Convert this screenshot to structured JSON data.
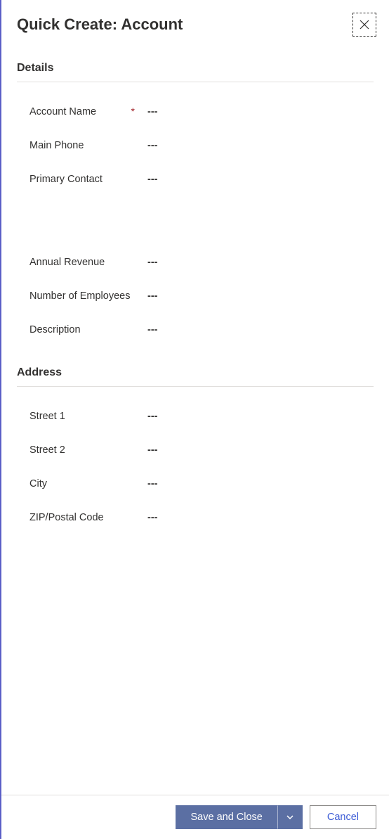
{
  "header": {
    "title": "Quick Create: Account"
  },
  "sections": {
    "details": {
      "title": "Details",
      "fields": {
        "account_name": {
          "label": "Account Name",
          "value": "---",
          "required": true
        },
        "main_phone": {
          "label": "Main Phone",
          "value": "---",
          "required": false
        },
        "primary_contact": {
          "label": "Primary Contact",
          "value": "---",
          "required": false
        },
        "annual_revenue": {
          "label": "Annual Revenue",
          "value": "---",
          "required": false
        },
        "num_employees": {
          "label": "Number of Employees",
          "value": "---",
          "required": false
        },
        "description": {
          "label": "Description",
          "value": "---",
          "required": false
        }
      }
    },
    "address": {
      "title": "Address",
      "fields": {
        "street1": {
          "label": "Street 1",
          "value": "---",
          "required": false
        },
        "street2": {
          "label": "Street 2",
          "value": "---",
          "required": false
        },
        "city": {
          "label": "City",
          "value": "---",
          "required": false
        },
        "zip": {
          "label": "ZIP/Postal Code",
          "value": "---",
          "required": false
        }
      }
    }
  },
  "footer": {
    "save_label": "Save and Close",
    "cancel_label": "Cancel"
  },
  "required_marker": "*"
}
